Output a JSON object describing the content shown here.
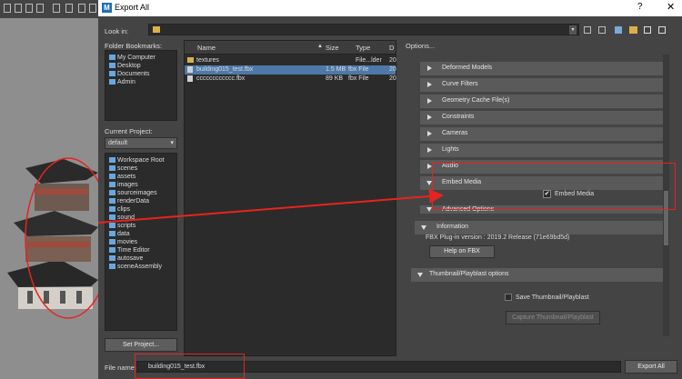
{
  "dialog": {
    "title": "Export All",
    "help": "?",
    "close": "✕"
  },
  "look_in": {
    "label": "Look in:"
  },
  "bookmarks": {
    "label": "Folder Bookmarks:",
    "items": [
      "My Computer",
      "Desktop",
      "Documents",
      "Admin"
    ]
  },
  "project": {
    "label": "Current Project:",
    "selected": "default",
    "items": [
      "Workspace Root",
      "scenes",
      "assets",
      "images",
      "sourceimages",
      "renderData",
      "clips",
      "sound",
      "scripts",
      "data",
      "movies",
      "Time Editor",
      "autosave",
      "sceneAssembly"
    ],
    "set_button": "Set Project..."
  },
  "files": {
    "columns": [
      "Name",
      "Size",
      "Type",
      "D"
    ],
    "rows": [
      {
        "name": "textures",
        "size": "",
        "type": "File...lder",
        "date": "20"
      },
      {
        "name": "building015_test.fbx",
        "size": "1.5 MB",
        "type": "fbx File",
        "date": "20"
      },
      {
        "name": "cccccccccccc.fbx",
        "size": "89 KB",
        "type": "fbx File",
        "date": "20"
      }
    ]
  },
  "options": {
    "label": "Options...",
    "sections": [
      "Deformed Models",
      "Curve Filters",
      "Geometry Cache File(s)",
      "Constraints",
      "Cameras",
      "Lights",
      "Audio"
    ],
    "embed": {
      "title": "Embed Media",
      "checkbox": "Embed Media",
      "checked": true
    },
    "advanced": "Advanced Options",
    "information": {
      "title": "Information",
      "version_text": "FBX Plug-in version : 2019.2 Release (71e69bd5d)",
      "help_button": "Help on FBX"
    },
    "thumbnail": {
      "title": "Thumbnail/Playblast options",
      "save_label": "Save Thumbnail/Playblast",
      "capture_button": "Capture Thumbnail/Playblast"
    }
  },
  "bottom": {
    "file_name_label": "File name:",
    "file_name_value": "building015_test.fbx",
    "export_button": "Export All"
  },
  "colors": {
    "annotation": "#e8231f",
    "selection": "#4d78a8"
  }
}
